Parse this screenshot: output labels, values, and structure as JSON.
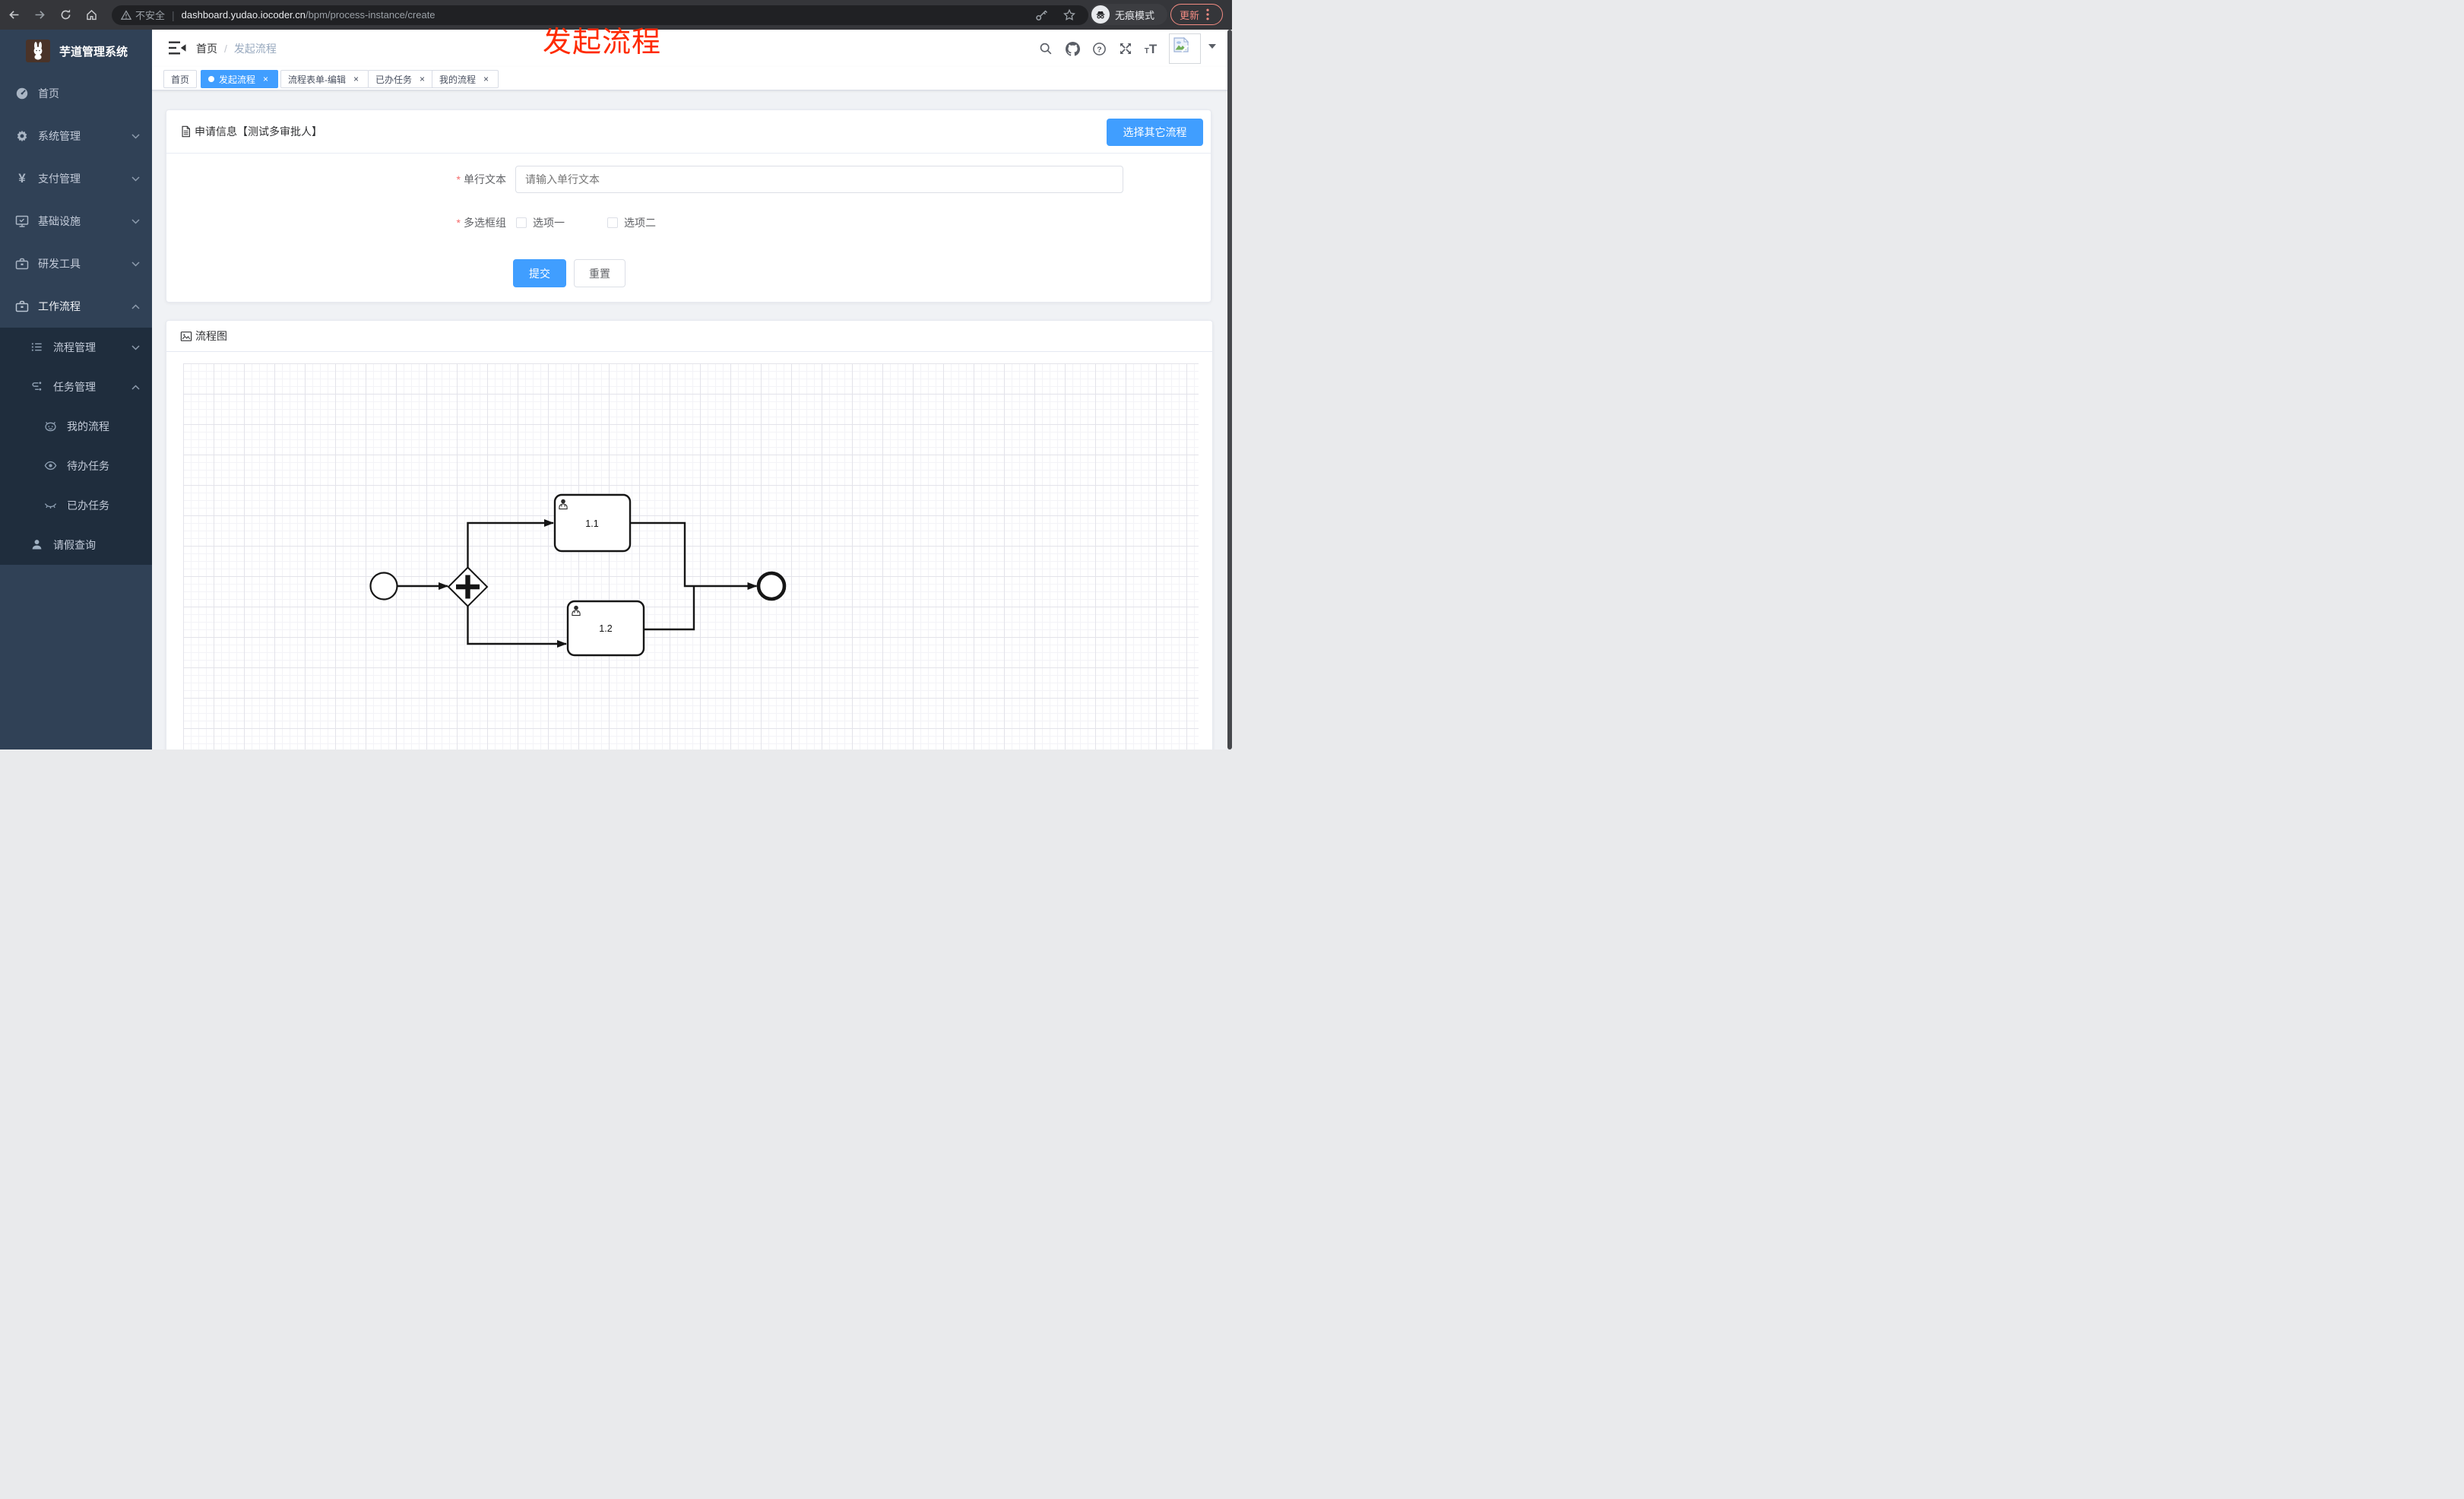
{
  "browser": {
    "security_label": "不安全",
    "url_host": "dashboard.yudao.iocoder.cn",
    "url_path": "/bpm/process-instance/create",
    "incognito_label": "无痕模式",
    "update_label": "更新"
  },
  "annotation": {
    "text": "发起流程",
    "color": "#ff2a00"
  },
  "sidebar": {
    "title": "芋道管理系统",
    "menu": [
      {
        "label": "首页",
        "icon": "dashboard-icon",
        "level": 1
      },
      {
        "label": "系统管理",
        "icon": "gear-icon",
        "level": 1,
        "chevron": "down"
      },
      {
        "label": "支付管理",
        "icon": "currency-yen-icon",
        "level": 1,
        "chevron": "down"
      },
      {
        "label": "基础设施",
        "icon": "monitor-icon",
        "level": 1,
        "chevron": "down"
      },
      {
        "label": "研发工具",
        "icon": "toolbox-icon",
        "level": 1,
        "chevron": "down"
      },
      {
        "label": "工作流程",
        "icon": "toolbox-icon",
        "level": 1,
        "chevron": "up",
        "expanded": true
      },
      {
        "label": "流程管理",
        "icon": "list-icon",
        "level": 2,
        "chevron": "down"
      },
      {
        "label": "任务管理",
        "icon": "workflow-icon",
        "level": 2,
        "chevron": "up",
        "expanded": true
      },
      {
        "label": "我的流程",
        "icon": "face-icon",
        "level": 3
      },
      {
        "label": "待办任务",
        "icon": "eye-open-icon",
        "level": 3
      },
      {
        "label": "已办任务",
        "icon": "eye-closed-icon",
        "level": 3
      },
      {
        "label": "请假查询",
        "icon": "user-icon",
        "level": 2
      }
    ]
  },
  "header": {
    "breadcrumb": {
      "home": "首页",
      "separator": "/",
      "current": "发起流程"
    },
    "icons": [
      "search-icon",
      "github-icon",
      "help-icon",
      "fullscreen-icon",
      "font-size-icon"
    ],
    "avatar": "broken-image"
  },
  "tabs": [
    {
      "label": "首页",
      "active": false,
      "closable": false
    },
    {
      "label": "发起流程",
      "active": true,
      "closable": true
    },
    {
      "label": "流程表单-编辑",
      "active": false,
      "closable": true
    },
    {
      "label": "已办任务",
      "active": false,
      "closable": true
    },
    {
      "label": "我的流程",
      "active": false,
      "closable": true
    }
  ],
  "form_card": {
    "title": "申请信息【测试多审批人】",
    "action_button": "选择其它流程",
    "fields": [
      {
        "label": "单行文本",
        "required": true,
        "type": "text",
        "value": "",
        "placeholder": "请输入单行文本"
      },
      {
        "label": "多选框组",
        "required": true,
        "type": "checkbox-group",
        "options": [
          {
            "label": "选项一",
            "checked": false
          },
          {
            "label": "选项二",
            "checked": false
          }
        ]
      }
    ],
    "submit_label": "提交",
    "reset_label": "重置"
  },
  "diagram_card": {
    "title": "流程图",
    "bpmn": {
      "nodes": [
        {
          "id": "StartEvent",
          "type": "start-event",
          "label": ""
        },
        {
          "id": "ParallelGateway",
          "type": "parallel-gateway",
          "label": ""
        },
        {
          "id": "UserTask1",
          "type": "user-task",
          "label": "1.1"
        },
        {
          "id": "UserTask2",
          "type": "user-task",
          "label": "1.2"
        },
        {
          "id": "EndEvent",
          "type": "end-event",
          "label": ""
        }
      ],
      "flows": [
        {
          "from": "StartEvent",
          "to": "ParallelGateway"
        },
        {
          "from": "ParallelGateway",
          "to": "UserTask1"
        },
        {
          "from": "ParallelGateway",
          "to": "UserTask2"
        },
        {
          "from": "UserTask1",
          "to": "EndEvent"
        },
        {
          "from": "UserTask2",
          "to": "EndEvent"
        }
      ]
    }
  },
  "colors": {
    "primary": "#409eff",
    "sidebar_bg": "#304156",
    "submenu_bg": "#1f2d3d",
    "content_bg": "#f0f2f5",
    "chrome_bg": "#35363a",
    "annotation_red": "#ff2a00",
    "update_red": "#f28b82"
  }
}
